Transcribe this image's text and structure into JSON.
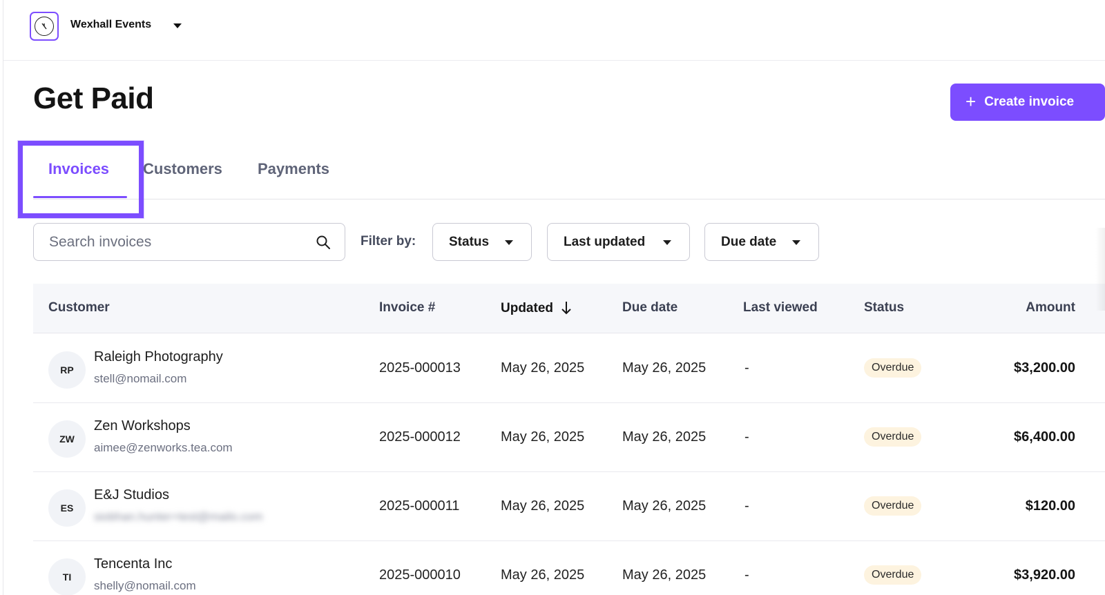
{
  "org": {
    "name": "Wexhall Events",
    "logo_icon": "brand-logo-icon"
  },
  "header": {
    "title": "Get Paid",
    "create_label": "Create invoice"
  },
  "tabs": [
    {
      "label": "Invoices",
      "active": true
    },
    {
      "label": "Customers",
      "active": false
    },
    {
      "label": "Payments",
      "active": false
    }
  ],
  "filters": {
    "search_placeholder": "Search invoices",
    "filter_by_label": "Filter by:",
    "status_label": "Status",
    "last_updated_label": "Last updated",
    "due_date_label": "Due date"
  },
  "table": {
    "columns": {
      "customer": "Customer",
      "invoice": "Invoice #",
      "updated": "Updated",
      "due_date": "Due date",
      "last_viewed": "Last viewed",
      "status": "Status",
      "amount": "Amount"
    },
    "rows": [
      {
        "initials": "RP",
        "name": "Raleigh Photography",
        "email": "stell@nomail.com",
        "email_blurred": false,
        "invoice": "2025-000013",
        "updated": "May 26, 2025",
        "due": "May 26, 2025",
        "viewed": "-",
        "status": "Overdue",
        "amount": "$3,200.00"
      },
      {
        "initials": "ZW",
        "name": "Zen Workshops",
        "email": "aimee@zenworks.tea.com",
        "email_blurred": false,
        "invoice": "2025-000012",
        "updated": "May 26, 2025",
        "due": "May 26, 2025",
        "viewed": "-",
        "status": "Overdue",
        "amount": "$6,400.00"
      },
      {
        "initials": "ES",
        "name": "E&J Studios",
        "email": "siobhan.hunter+test@mailo.com",
        "email_blurred": true,
        "invoice": "2025-000011",
        "updated": "May 26, 2025",
        "due": "May 26, 2025",
        "viewed": "-",
        "status": "Overdue",
        "amount": "$120.00"
      },
      {
        "initials": "TI",
        "name": "Tencenta Inc",
        "email": "shelly@nomail.com",
        "email_blurred": false,
        "invoice": "2025-000010",
        "updated": "May 26, 2025",
        "due": "May 26, 2025",
        "viewed": "-",
        "status": "Overdue",
        "amount": "$3,920.00"
      }
    ]
  },
  "colors": {
    "accent": "#7c4dff",
    "status_overdue_bg": "#fdf3df"
  }
}
